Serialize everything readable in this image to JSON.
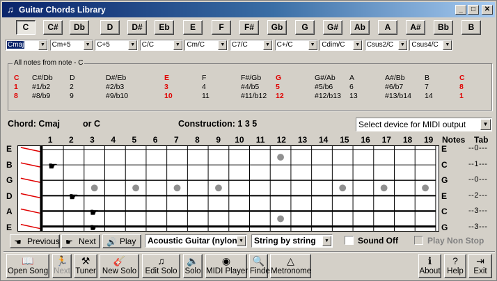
{
  "window": {
    "title": "Guitar Chords Library",
    "icon": "guitar-icon"
  },
  "notes": [
    "C",
    "C#",
    "Db",
    "D",
    "D#",
    "Eb",
    "E",
    "F",
    "F#",
    "Gb",
    "G",
    "G#",
    "Ab",
    "A",
    "A#",
    "Bb",
    "B"
  ],
  "active_note": "C",
  "chord_selects": [
    "Cmaj",
    "Cm+5",
    "C+5",
    "C/C",
    "Cm/C",
    "C7/C",
    "C+/C",
    "Cdim/C",
    "Csus2/C",
    "Csus4/C"
  ],
  "notes_group": {
    "title": "All notes from note - C",
    "columns": [
      {
        "rows": [
          "C",
          "1",
          "8"
        ],
        "highlight": true
      },
      {
        "rows": [
          "C#/Db",
          "#1/b2",
          "#8/b9"
        ],
        "highlight": false
      },
      {
        "rows": [
          "D",
          "2",
          "9"
        ],
        "highlight": false
      },
      {
        "rows": [
          "D#/Eb",
          "#2/b3",
          "#9/b10"
        ],
        "highlight": false
      },
      {
        "rows": [
          "E",
          "3",
          "10"
        ],
        "highlight": true
      },
      {
        "rows": [
          "F",
          "4",
          "11"
        ],
        "highlight": false
      },
      {
        "rows": [
          "F#/Gb",
          "#4/b5",
          "#11/b12"
        ],
        "highlight": false
      },
      {
        "rows": [
          "G",
          "5",
          "12"
        ],
        "highlight": true
      },
      {
        "rows": [
          "G#/Ab",
          "#5/b6",
          "#12/b13"
        ],
        "highlight": false
      },
      {
        "rows": [
          "A",
          "6",
          "13"
        ],
        "highlight": false
      },
      {
        "rows": [
          "A#/Bb",
          "#6/b7",
          "#13/b14"
        ],
        "highlight": false
      },
      {
        "rows": [
          "B",
          "7",
          "14"
        ],
        "highlight": false
      },
      {
        "rows": [
          "C",
          "8",
          "1"
        ],
        "highlight": true
      }
    ]
  },
  "chord_info": {
    "chord": "Chord: Cmaj",
    "or": "or C",
    "construction": "Construction: 1 3 5"
  },
  "midi_device": "Select device for MIDI output",
  "fret_numbers": [
    "1",
    "2",
    "3",
    "4",
    "5",
    "6",
    "7",
    "8",
    "9",
    "10",
    "11",
    "12",
    "13",
    "14",
    "15",
    "16",
    "17",
    "18",
    "19"
  ],
  "fretboard_headers": {
    "notes": "Notes",
    "tab": "Tab"
  },
  "strings": [
    {
      "label": "E",
      "note": "E",
      "tab": "--0---"
    },
    {
      "label": "B",
      "note": "C",
      "tab": "--1---"
    },
    {
      "label": "G",
      "note": "G",
      "tab": "--0---"
    },
    {
      "label": "D",
      "note": "E",
      "tab": "--2---"
    },
    {
      "label": "A",
      "note": "C",
      "tab": "--3---"
    },
    {
      "label": "E",
      "note": "G",
      "tab": "--3---"
    }
  ],
  "playback": {
    "previous": "Previous",
    "next": "Next",
    "play": "Play",
    "instrument": "Acoustic Guitar (nylon",
    "mode": "String by string",
    "sound_off": "Sound Off",
    "play_non_stop": "Play Non Stop"
  },
  "toolbar": [
    {
      "label": "Open Song",
      "icon": "book-icon",
      "enabled": true
    },
    {
      "label": "Next",
      "icon": "runner-icon",
      "enabled": false
    },
    {
      "label": "Tuner",
      "icon": "tuner-icon",
      "enabled": true
    },
    {
      "label": "New Solo",
      "icon": "guitar-icon",
      "enabled": true
    },
    {
      "label": "Edit Solo",
      "icon": "notes-icon",
      "enabled": true
    },
    {
      "label": "Solo",
      "icon": "speaker-icon",
      "enabled": true
    },
    {
      "label": "MIDI Player",
      "icon": "cd-icon",
      "enabled": true
    },
    {
      "label": "Finder",
      "icon": "magnifier-icon",
      "enabled": true
    },
    {
      "label": "Metronome",
      "icon": "metronome-icon",
      "enabled": true
    },
    {
      "label": "About",
      "icon": "info-icon",
      "enabled": true
    },
    {
      "label": "Help",
      "icon": "help-icon",
      "enabled": true
    },
    {
      "label": "Exit",
      "icon": "exit-icon",
      "enabled": true
    }
  ],
  "fingers": [
    {
      "string": 1,
      "fret": 1
    },
    {
      "string": 3,
      "fret": 2
    },
    {
      "string": 4,
      "fret": 3
    },
    {
      "string": 5,
      "fret": 3
    }
  ],
  "markers": [
    3,
    5,
    7,
    9,
    12,
    15,
    17,
    19
  ]
}
